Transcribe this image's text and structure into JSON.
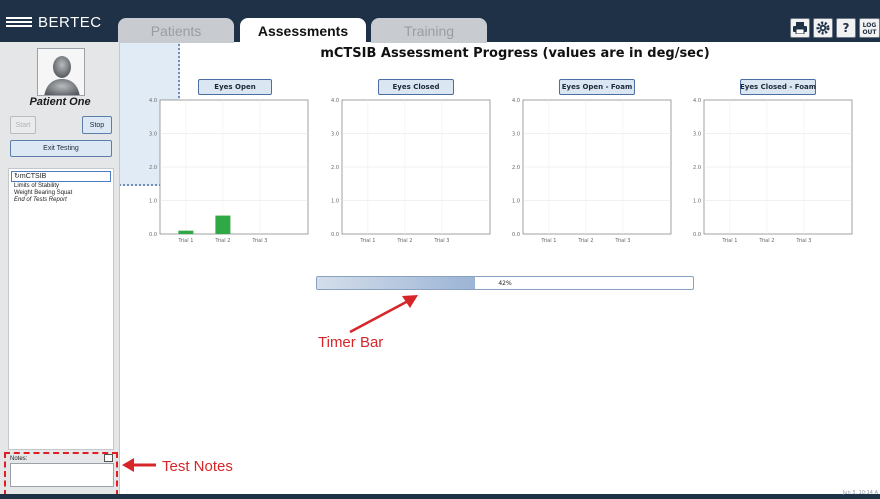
{
  "app": {
    "brand": "BERTEC",
    "tabs": [
      {
        "label": "Patients"
      },
      {
        "label": "Assessments"
      },
      {
        "label": "Training"
      }
    ],
    "toolbar": {
      "printer_icon": "printer-icon",
      "settings_icon": "gear-icon",
      "help_label": "?",
      "logout_label": "LOG OUT"
    }
  },
  "sidebar": {
    "patient_name": "Patient One",
    "start_label": "Start",
    "stop_label": "Stop",
    "exit_label": "Exit Testing",
    "tests": [
      {
        "label": "mCTSIB"
      },
      {
        "label": "Limits of Stability"
      },
      {
        "label": "Weight Bearing Squat"
      },
      {
        "label": "End of Tests Report"
      }
    ],
    "notes_label": "Notes:"
  },
  "main": {
    "title": "mCTSIB Assessment Progress (values are in deg/sec)",
    "progress": {
      "percent": 42,
      "label": "42%"
    }
  },
  "chart_data": [
    {
      "type": "bar",
      "title": "Eyes Open",
      "categories": [
        "Trial 1",
        "Trial 2",
        "Trial 3"
      ],
      "values": [
        0.1,
        0.55,
        null
      ],
      "ylim": [
        0,
        4.0
      ],
      "yticks": [
        "0.0",
        "1.0",
        "2.0",
        "3.0",
        "4.0"
      ],
      "color": "#2fa845",
      "grid": true
    },
    {
      "type": "bar",
      "title": "Eyes Closed",
      "categories": [
        "Trial 1",
        "Trial 2",
        "Trial 3"
      ],
      "values": [
        null,
        null,
        null
      ],
      "ylim": [
        0,
        4.0
      ],
      "yticks": [
        "0.0",
        "1.0",
        "2.0",
        "3.0",
        "4.0"
      ],
      "color": "#2fa845",
      "grid": true
    },
    {
      "type": "bar",
      "title": "Eyes Open - Foam",
      "categories": [
        "Trial 1",
        "Trial 2",
        "Trial 3"
      ],
      "values": [
        null,
        null,
        null
      ],
      "ylim": [
        0,
        4.0
      ],
      "yticks": [
        "0.0",
        "1.0",
        "2.0",
        "3.0",
        "4.0"
      ],
      "color": "#2fa845",
      "grid": true
    },
    {
      "type": "bar",
      "title": "Eyes Closed - Foam",
      "categories": [
        "Trial 1",
        "Trial 2",
        "Trial 3"
      ],
      "values": [
        null,
        null,
        null
      ],
      "ylim": [
        0,
        4.0
      ],
      "yticks": [
        "0.0",
        "1.0",
        "2.0",
        "3.0",
        "4.0"
      ],
      "color": "#2fa845",
      "grid": true
    }
  ],
  "annotations": {
    "timer_bar": "Timer Bar",
    "test_notes": "Test Notes",
    "color": "#d6262a"
  },
  "footer": {
    "datetime": "Jun 3, 10:14 A"
  }
}
